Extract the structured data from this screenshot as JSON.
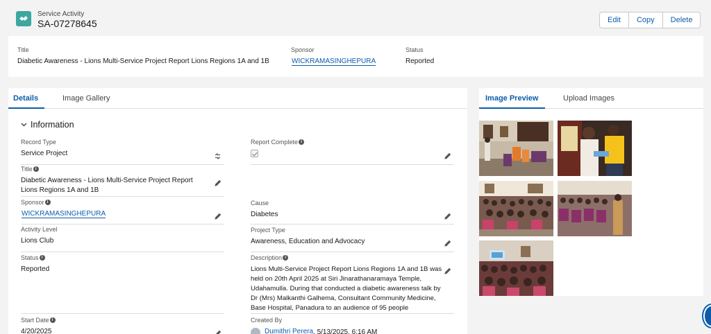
{
  "header": {
    "kicker": "Service Activity",
    "title": "SA-07278645",
    "icon": "handshake-icon",
    "buttons": {
      "edit": "Edit",
      "copy": "Copy",
      "delete": "Delete"
    }
  },
  "highlights": {
    "title_label": "Title",
    "title_value": "Diabetic Awareness - Lions Multi-Service Project Report Lions Regions 1A and 1B",
    "sponsor_label": "Sponsor",
    "sponsor_value": "WICKRAMASINGHEPURA",
    "status_label": "Status",
    "status_value": "Reported"
  },
  "details_tabs": {
    "details": "Details",
    "gallery": "Image Gallery"
  },
  "section": {
    "title": "Information"
  },
  "fields": {
    "record_type": {
      "label": "Record Type",
      "value": "Service Project"
    },
    "report_complete": {
      "label": "Report Complete",
      "checked": true
    },
    "title": {
      "label": "Title",
      "value": "Diabetic Awareness - Lions Multi-Service Project Report Lions Regions 1A and 1B"
    },
    "sponsor": {
      "label": "Sponsor",
      "value": "WICKRAMASINGHEPURA"
    },
    "cause": {
      "label": "Cause",
      "value": "Diabetes"
    },
    "activity_level": {
      "label": "Activity Level",
      "value": "Lions Club"
    },
    "project_type": {
      "label": "Project Type",
      "value": "Awareness, Education and Advocacy"
    },
    "status": {
      "label": "Status",
      "value": "Reported"
    },
    "description": {
      "label": "Description",
      "value": "Lions Multi-Service Project Report Lions Regions 1A and 1B was held on 20th April 2025 at Siri Jinarathanaramaya Temple, Udahamulla. During that conducted a diabetic awareness talk by Dr (Mrs) Malkanthi Galhema, Consultant Community Medicine, Base Hospital, Panadura to an audience of 95 people"
    },
    "start_date": {
      "label": "Start Date",
      "value": "4/20/2025"
    },
    "created_by": {
      "label": "Created By",
      "user": "Dumithri Perera",
      "date": ", 5/13/2025, 6:16 AM"
    }
  },
  "right_tabs": {
    "preview": "Image Preview",
    "upload": "Upload Images"
  },
  "images": [
    {
      "name": "photo-1"
    },
    {
      "name": "photo-2"
    },
    {
      "name": "photo-3"
    },
    {
      "name": "photo-4"
    },
    {
      "name": "photo-5"
    }
  ],
  "colors": {
    "brand": "#0b5cab",
    "app_icon": "#3ba7a0"
  }
}
